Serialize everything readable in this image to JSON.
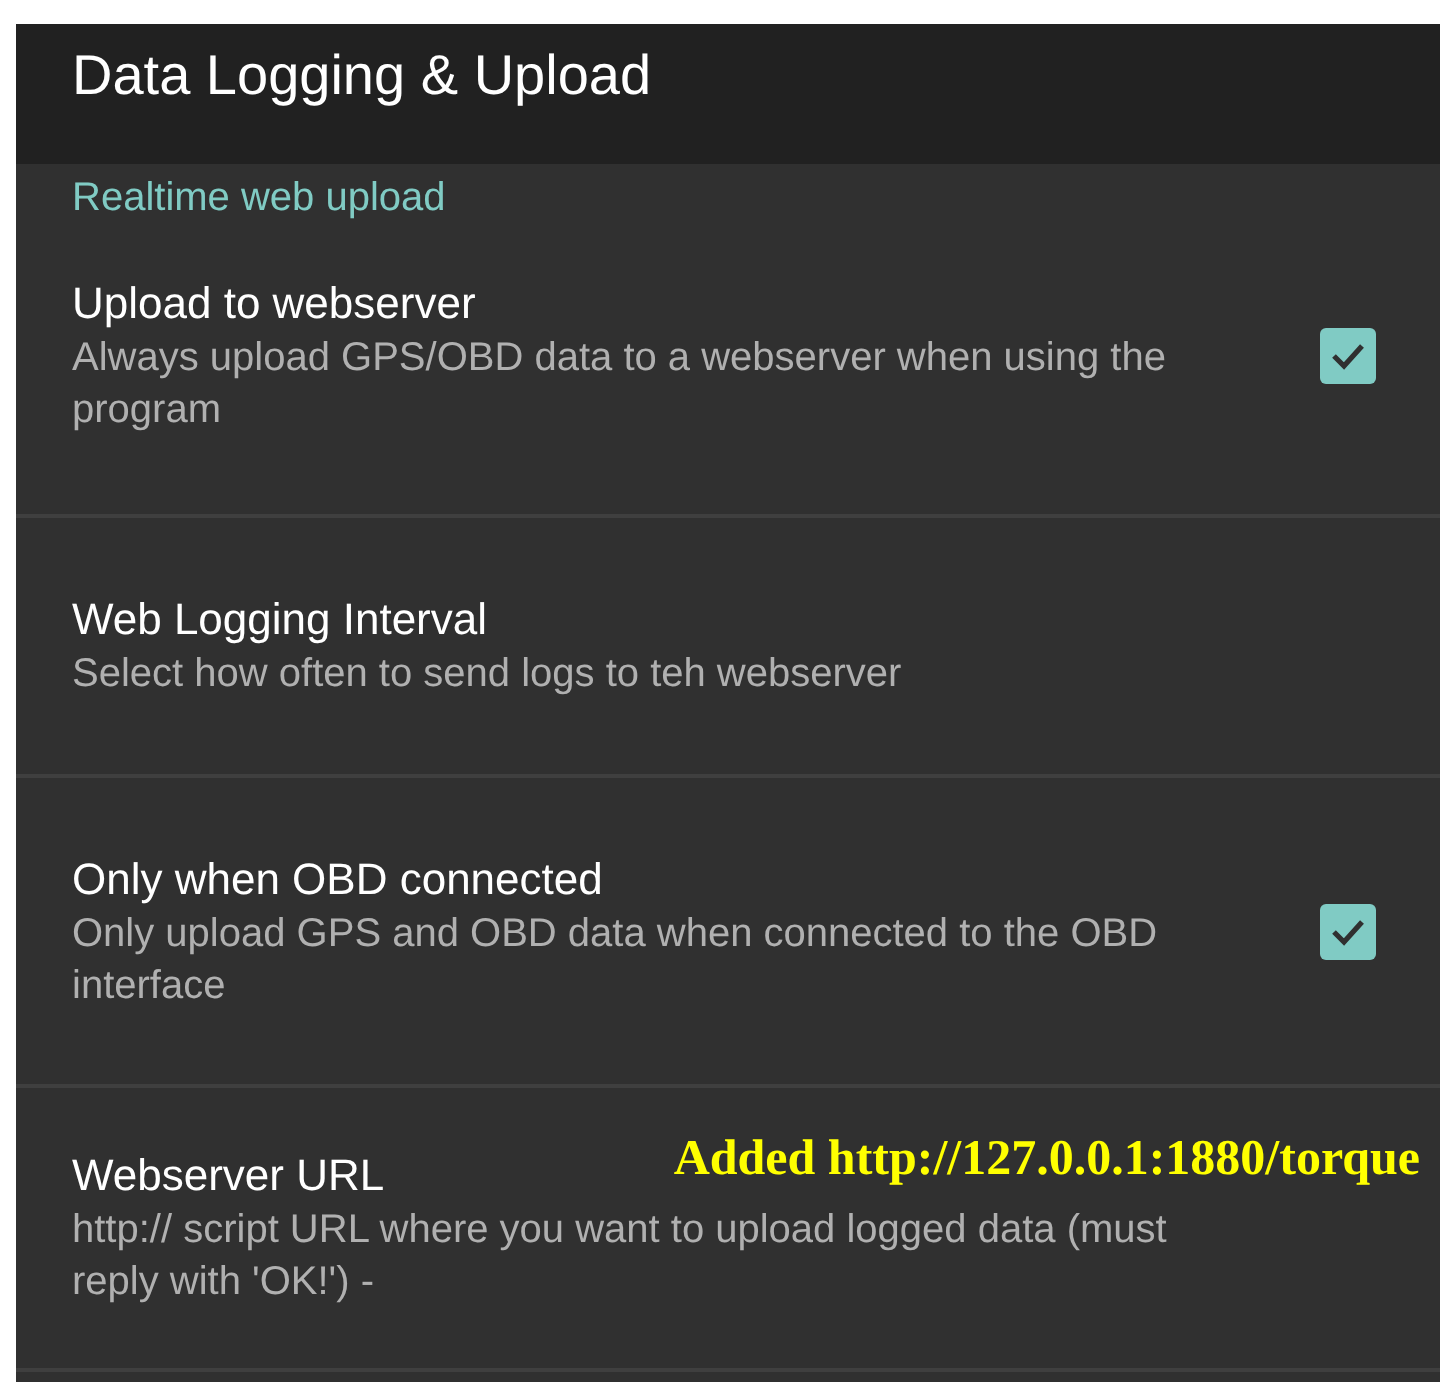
{
  "header": {
    "title": "Data Logging & Upload"
  },
  "section": {
    "title": "Realtime web upload"
  },
  "preferences": [
    {
      "kind": "checkbox",
      "title": "Upload to webserver",
      "summary": "Always upload GPS/OBD data to a webserver when using the program",
      "checked": true
    },
    {
      "kind": "plain",
      "title": "Web Logging Interval",
      "summary": "Select how often to send logs to teh webserver"
    },
    {
      "kind": "checkbox",
      "title": "Only when OBD connected",
      "summary": "Only upload GPS and OBD data when connected to the OBD interface",
      "checked": true
    },
    {
      "kind": "plain",
      "title": "Webserver URL",
      "summary": "http:// script URL where you want to upload logged data (must reply with 'OK!') -",
      "annotation": "Added http://127.0.0.1:1880/torque"
    }
  ]
}
